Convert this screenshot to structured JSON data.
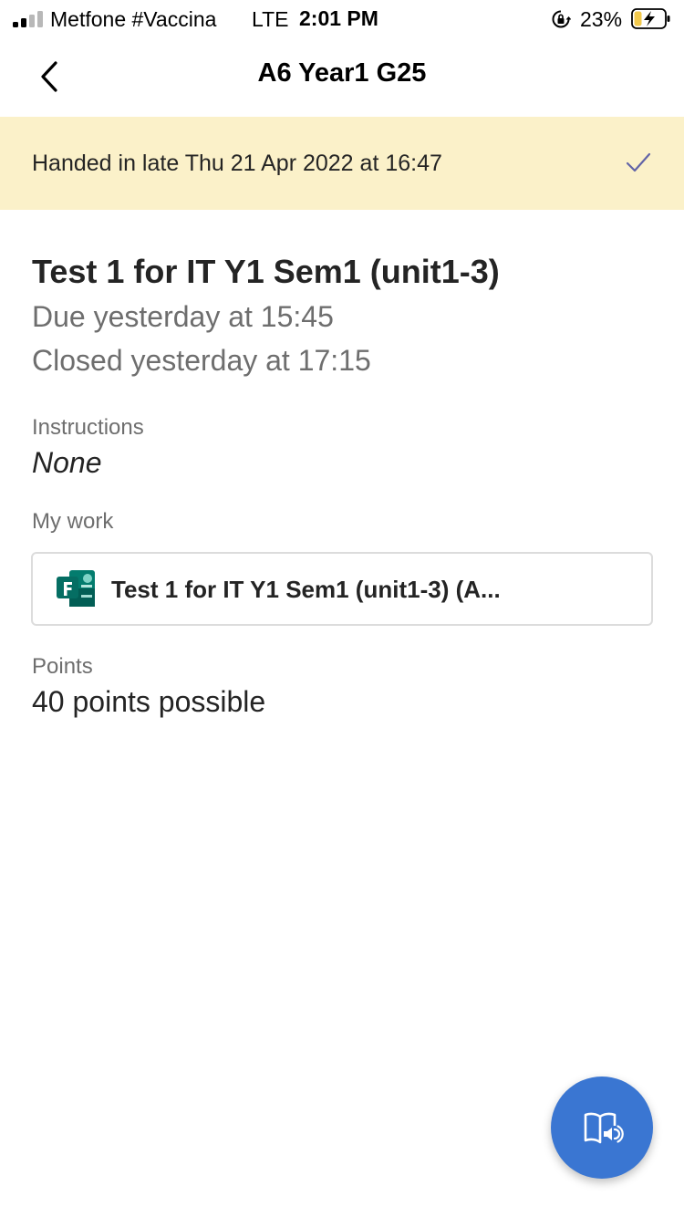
{
  "status_bar": {
    "carrier": "Metfone #Vaccina",
    "network": "LTE",
    "time": "2:01 PM",
    "battery_percent": "23%",
    "signal_bars_active": 2,
    "signal_bars_total": 4,
    "battery_level": 0.23,
    "charging": true
  },
  "nav": {
    "title": "A6 Year1 G25",
    "back_icon": "chevron-left-icon"
  },
  "banner": {
    "text": "Handed in late Thu 21 Apr 2022 at 16:47",
    "icon": "checkmark-icon",
    "background": "#fbf1c9"
  },
  "assignment": {
    "title": "Test 1 for IT Y1 Sem1 (unit1-3)",
    "due": "Due yesterday at 15:45",
    "closed": "Closed yesterday at 17:15"
  },
  "instructions": {
    "label": "Instructions",
    "value": "None"
  },
  "my_work": {
    "label": "My work",
    "item": {
      "icon": "microsoft-forms-icon",
      "title": "Test 1 for IT Y1 Sem1 (unit1-3) (A..."
    }
  },
  "points": {
    "label": "Points",
    "value": "40 points possible"
  },
  "fab": {
    "icon": "immersive-reader-icon",
    "color": "#3a76d2"
  }
}
